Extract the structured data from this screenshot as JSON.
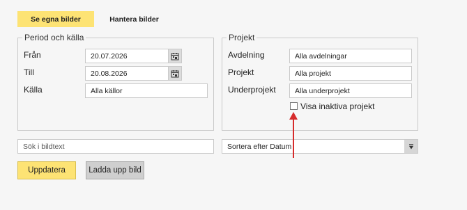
{
  "tabs": [
    {
      "label": "Se egna bilder",
      "active": true
    },
    {
      "label": "Hantera bilder",
      "active": false
    }
  ],
  "period_group": {
    "legend": "Period och källa",
    "from_label": "Från",
    "from_value": "20.07.2026",
    "to_label": "Till",
    "to_value": "20.08.2026",
    "source_label": "Källa",
    "source_value": "Alla källor"
  },
  "project_group": {
    "legend": "Projekt",
    "department_label": "Avdelning",
    "department_value": "Alla avdelningar",
    "project_label": "Projekt",
    "project_value": "Alla projekt",
    "subproject_label": "Underprojekt",
    "subproject_value": "Alla underprojekt",
    "inactive_checkbox_label": "Visa inaktiva projekt",
    "inactive_checked": false
  },
  "search": {
    "placeholder": "Sök i bildtext",
    "value": ""
  },
  "sort": {
    "selected": "Sortera efter Datum"
  },
  "buttons": {
    "update": "Uppdatera",
    "upload": "Ladda upp bild"
  },
  "colors": {
    "accent": "#fde374",
    "annotation_arrow": "#d62b2b"
  },
  "icons": {
    "calendar": "calendar-icon",
    "dropdown": "chevron-down-icon"
  }
}
